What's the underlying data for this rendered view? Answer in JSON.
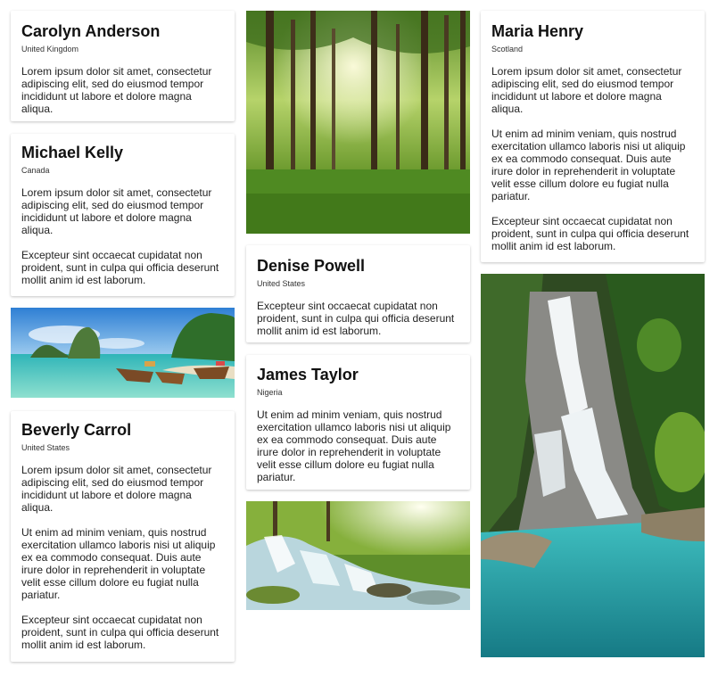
{
  "cards": {
    "carolyn": {
      "name": "Carolyn Anderson",
      "location": "United Kingdom",
      "paragraphs": [
        "Lorem ipsum dolor sit amet, consectetur adipiscing elit, sed do eiusmod tempor incididunt ut labore et dolore magna aliqua."
      ]
    },
    "michael": {
      "name": "Michael Kelly",
      "location": "Canada",
      "paragraphs": [
        "Lorem ipsum dolor sit amet, consectetur adipiscing elit, sed do eiusmod tempor incididunt ut labore et dolore magna aliqua.",
        "Excepteur sint occaecat cupidatat non proident, sunt in culpa qui officia deserunt mollit anim id est laborum."
      ]
    },
    "beverly": {
      "name": "Beverly Carrol",
      "location": "United States",
      "paragraphs": [
        "Lorem ipsum dolor sit amet, consectetur adipiscing elit, sed do eiusmod tempor incididunt ut labore et dolore magna aliqua.",
        "Ut enim ad minim veniam, quis nostrud exercitation ullamco laboris nisi ut aliquip ex ea commodo consequat. Duis aute irure dolor in reprehenderit in voluptate velit esse cillum dolore eu fugiat nulla pariatur.",
        "Excepteur sint occaecat cupidatat non proident, sunt in culpa qui officia deserunt mollit anim id est laborum."
      ]
    },
    "denise": {
      "name": "Denise Powell",
      "location": "United States",
      "paragraphs": [
        "Excepteur sint occaecat cupidatat non proident, sunt in culpa qui officia deserunt mollit anim id est laborum."
      ]
    },
    "james": {
      "name": "James Taylor",
      "location": "Nigeria",
      "paragraphs": [
        "Ut enim ad minim veniam, quis nostrud exercitation ullamco laboris nisi ut aliquip ex ea commodo consequat. Duis aute irure dolor in reprehenderit in voluptate velit esse cillum dolore eu fugiat nulla pariatur."
      ]
    },
    "maria": {
      "name": "Maria Henry",
      "location": "Scotland",
      "paragraphs": [
        "Lorem ipsum dolor sit amet, consectetur adipiscing elit, sed do eiusmod tempor incididunt ut labore et dolore magna aliqua.",
        "Ut enim ad minim veniam, quis nostrud exercitation ullamco laboris nisi ut aliquip ex ea commodo consequat. Duis aute irure dolor in reprehenderit in voluptate velit esse cillum dolore eu fugiat nulla pariatur.",
        "Excepteur sint occaecat cupidatat non proident, sunt in culpa qui officia deserunt mollit anim id est laborum."
      ]
    }
  },
  "images": {
    "beach": "beach-boats-image",
    "forest": "forest-sunbeams-image",
    "stream": "forest-stream-image",
    "waterfall": "waterfall-image"
  }
}
